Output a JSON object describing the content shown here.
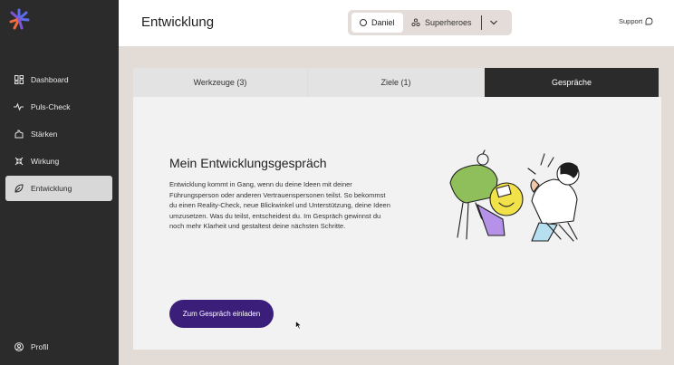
{
  "sidebar": {
    "items": [
      {
        "label": "Dashboard",
        "icon": "dashboard-icon"
      },
      {
        "label": "Puls-Check",
        "icon": "pulse-icon"
      },
      {
        "label": "Stärken",
        "icon": "strength-icon"
      },
      {
        "label": "Wirkung",
        "icon": "impact-icon"
      },
      {
        "label": "Entwicklung",
        "icon": "leaf-icon",
        "active": true
      }
    ],
    "profile_label": "Profil"
  },
  "header": {
    "title": "Entwicklung",
    "switcher": {
      "user": "Daniel",
      "team": "Superheroes"
    },
    "support_label": "Support"
  },
  "tabs": [
    {
      "label": "Werkzeuge (3)"
    },
    {
      "label": "Ziele (1)"
    },
    {
      "label": "Gespräche",
      "active": true
    }
  ],
  "panel": {
    "title": "Mein Entwicklungsgespräch",
    "text": "Entwicklung kommt in Gang, wenn du deine Ideen mit deiner Führungsperson oder anderen Vertrauenspersonen teilst. So bekommst du einen Reality-Check, neue Blickwinkel und Unterstützung, deine Ideen umzusetzen. Was du teilst, entscheidest du. Im Gespräch gewinnst du noch mehr Klarheit und gestaltest deine nächsten Schritte.",
    "cta_label": "Zum Gespräch einladen"
  },
  "colors": {
    "sidebar_bg": "#2b2b2b",
    "accent_purple": "#3b1e7a",
    "logo_blue": "#5b6cf0",
    "logo_orange": "#f26a3b"
  }
}
